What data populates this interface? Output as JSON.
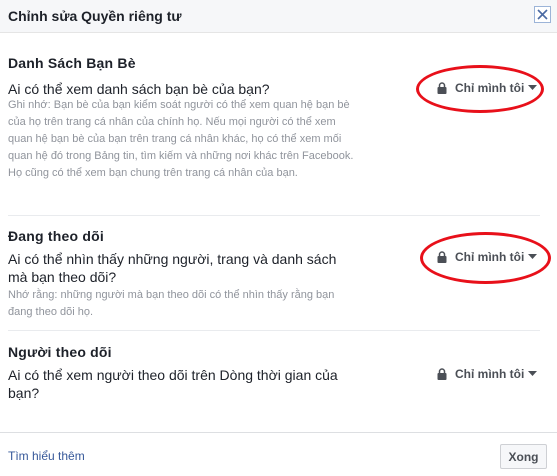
{
  "dialog": {
    "title": "Chỉnh sửa Quyền riêng tư",
    "close_icon": "close-icon"
  },
  "sections": [
    {
      "title": "Danh Sách Bạn Bè",
      "question": "Ai có thể xem danh sách bạn bè của bạn?",
      "note": "Ghi nhớ: Bạn bè của bạn kiểm soát người có thể xem quan hệ bạn bè của họ trên trang cá nhân của chính họ. Nếu mọi người có thể xem quan hệ bạn bè của bạn trên trang cá nhân khác, họ có thể xem mối quan hệ đó trong Bảng tin, tìm kiếm và những nơi khác trên Facebook. Họ cũng có thể xem bạn chung trên trang cá nhân của bạn.",
      "privacy_value": "Chỉ mình tôi"
    },
    {
      "title": "Đang theo dõi",
      "question": "Ai có thể nhìn thấy những người, trang và danh sách mà bạn theo dõi?",
      "note": "Nhớ rằng: những người mà bạn theo dõi có thể nhìn thấy rằng bạn đang theo dõi họ.",
      "privacy_value": "Chỉ mình tôi"
    },
    {
      "title": "Người theo dõi",
      "question": "Ai có thể xem người theo dõi trên Dòng thời gian của bạn?",
      "privacy_value": "Chỉ mình tôi"
    }
  ],
  "footer": {
    "learn_more": "Tìm hiểu thêm",
    "done_label": "Xong"
  },
  "colors": {
    "annotation_ellipse": "#e8101a",
    "link": "#365899",
    "note_text": "#90949c"
  }
}
